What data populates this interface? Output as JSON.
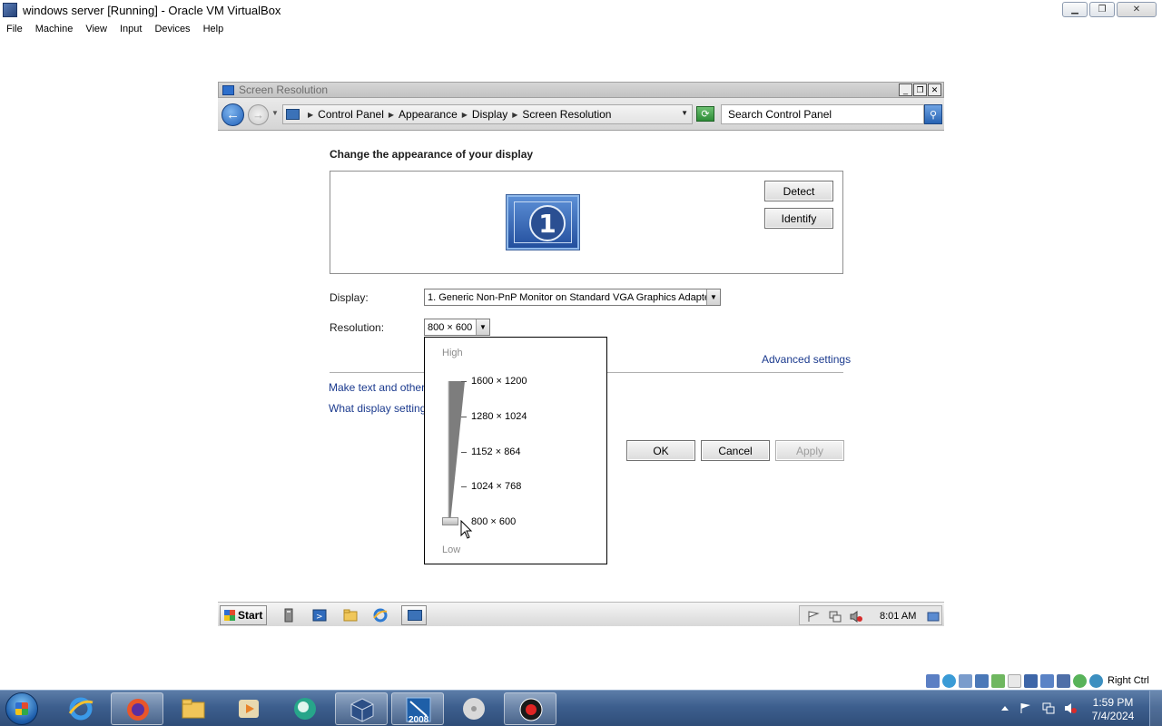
{
  "host": {
    "window_title": "windows server [Running] - Oracle VM VirtualBox",
    "window_buttons": [
      "minimize-icon",
      "restore-icon",
      "close-icon"
    ],
    "menu": [
      "File",
      "Machine",
      "View",
      "Input",
      "Devices",
      "Help"
    ],
    "status_bar": {
      "icons": [
        "hard-disk-icon",
        "optical-drive-icon",
        "audio-icon",
        "network-icon",
        "usb-icon",
        "shared-folders-icon",
        "display-icon",
        "recording-icon",
        "cpu-icon",
        "mouse-integration-icon",
        "keyboard-icon"
      ],
      "host_key_label": "Right Ctrl"
    },
    "taskbar": {
      "apps": [
        "internet-explorer-icon",
        "firefox-icon",
        "file-explorer-icon",
        "media-player-icon",
        "browser-icon",
        "virtualbox-icon",
        "app-2008-icon",
        "disk-icon",
        "screen-recorder-icon"
      ],
      "app_2008_label": "2008",
      "tray_icons": [
        "show-hidden-icons-icon",
        "action-center-flag-icon",
        "network-icon",
        "volume-muted-icon"
      ],
      "time": "1:59 PM",
      "date": "7/4/2024"
    }
  },
  "guest": {
    "window_title": "Screen Resolution",
    "breadcrumb": [
      "Control Panel",
      "Appearance",
      "Display",
      "Screen Resolution"
    ],
    "search_placeholder": "Search Control Panel",
    "heading": "Change the appearance of your display",
    "monitor_number": "1",
    "detect_label": "Detect",
    "identify_label": "Identify",
    "display_label": "Display:",
    "display_value": "1. Generic Non-PnP Monitor on Standard VGA Graphics Adapter",
    "resolution_label": "Resolution:",
    "resolution_value": "800 × 600",
    "advanced_link": "Advanced settings",
    "link_text_size": "Make text and other i",
    "link_display_settings": "What display settings",
    "ok_label": "OK",
    "cancel_label": "Cancel",
    "apply_label": "Apply",
    "resolution_dropdown": {
      "high_label": "High",
      "low_label": "Low",
      "options": [
        "1600 × 1200",
        "1280 × 1024",
        "1152 × 864",
        "1024 × 768",
        "800 × 600"
      ],
      "selected_index": 4
    },
    "taskbar": {
      "start_label": "Start",
      "clock": "8:01 AM"
    }
  }
}
